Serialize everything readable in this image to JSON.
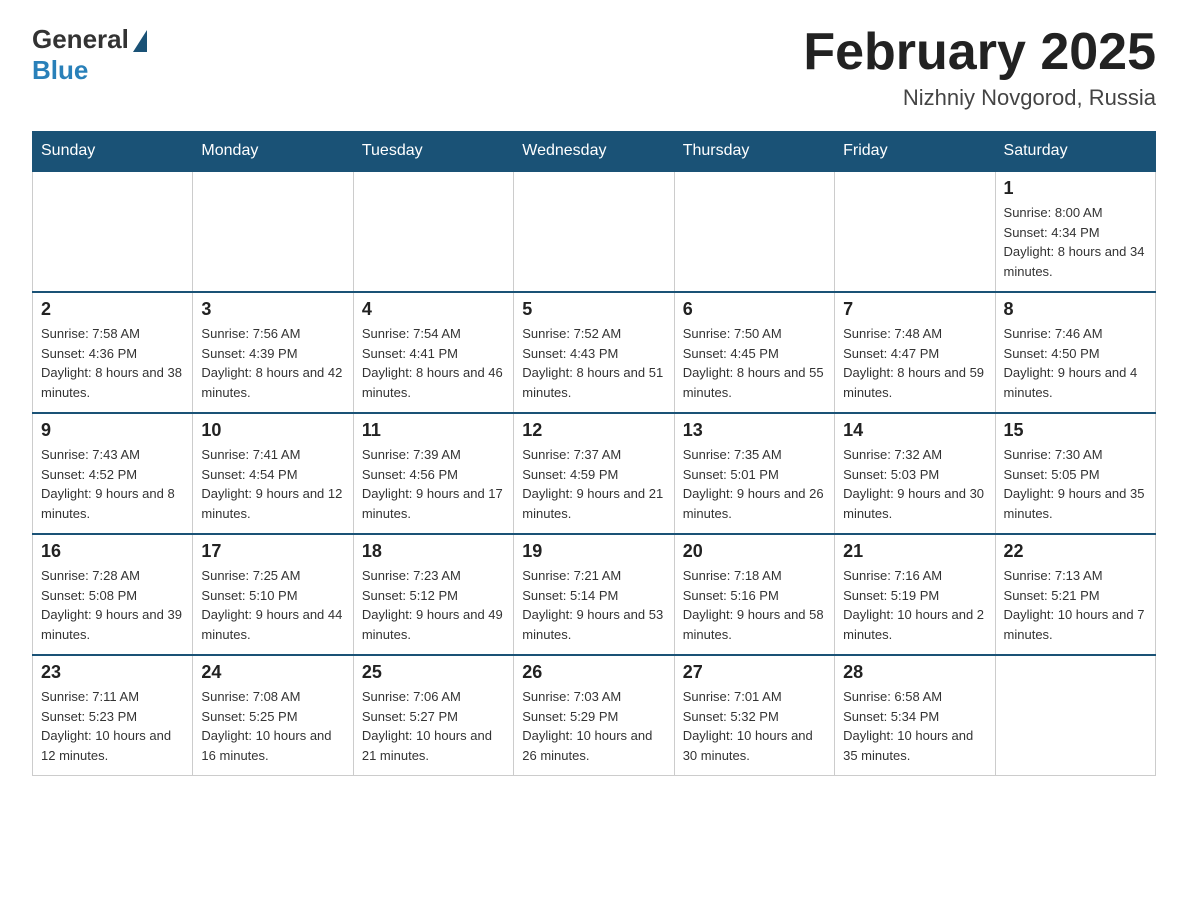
{
  "header": {
    "logo_general": "General",
    "logo_blue": "Blue",
    "month_title": "February 2025",
    "location": "Nizhniy Novgorod, Russia"
  },
  "weekdays": [
    "Sunday",
    "Monday",
    "Tuesday",
    "Wednesday",
    "Thursday",
    "Friday",
    "Saturday"
  ],
  "weeks": [
    [
      {
        "day": "",
        "info": ""
      },
      {
        "day": "",
        "info": ""
      },
      {
        "day": "",
        "info": ""
      },
      {
        "day": "",
        "info": ""
      },
      {
        "day": "",
        "info": ""
      },
      {
        "day": "",
        "info": ""
      },
      {
        "day": "1",
        "info": "Sunrise: 8:00 AM\nSunset: 4:34 PM\nDaylight: 8 hours and 34 minutes."
      }
    ],
    [
      {
        "day": "2",
        "info": "Sunrise: 7:58 AM\nSunset: 4:36 PM\nDaylight: 8 hours and 38 minutes."
      },
      {
        "day": "3",
        "info": "Sunrise: 7:56 AM\nSunset: 4:39 PM\nDaylight: 8 hours and 42 minutes."
      },
      {
        "day": "4",
        "info": "Sunrise: 7:54 AM\nSunset: 4:41 PM\nDaylight: 8 hours and 46 minutes."
      },
      {
        "day": "5",
        "info": "Sunrise: 7:52 AM\nSunset: 4:43 PM\nDaylight: 8 hours and 51 minutes."
      },
      {
        "day": "6",
        "info": "Sunrise: 7:50 AM\nSunset: 4:45 PM\nDaylight: 8 hours and 55 minutes."
      },
      {
        "day": "7",
        "info": "Sunrise: 7:48 AM\nSunset: 4:47 PM\nDaylight: 8 hours and 59 minutes."
      },
      {
        "day": "8",
        "info": "Sunrise: 7:46 AM\nSunset: 4:50 PM\nDaylight: 9 hours and 4 minutes."
      }
    ],
    [
      {
        "day": "9",
        "info": "Sunrise: 7:43 AM\nSunset: 4:52 PM\nDaylight: 9 hours and 8 minutes."
      },
      {
        "day": "10",
        "info": "Sunrise: 7:41 AM\nSunset: 4:54 PM\nDaylight: 9 hours and 12 minutes."
      },
      {
        "day": "11",
        "info": "Sunrise: 7:39 AM\nSunset: 4:56 PM\nDaylight: 9 hours and 17 minutes."
      },
      {
        "day": "12",
        "info": "Sunrise: 7:37 AM\nSunset: 4:59 PM\nDaylight: 9 hours and 21 minutes."
      },
      {
        "day": "13",
        "info": "Sunrise: 7:35 AM\nSunset: 5:01 PM\nDaylight: 9 hours and 26 minutes."
      },
      {
        "day": "14",
        "info": "Sunrise: 7:32 AM\nSunset: 5:03 PM\nDaylight: 9 hours and 30 minutes."
      },
      {
        "day": "15",
        "info": "Sunrise: 7:30 AM\nSunset: 5:05 PM\nDaylight: 9 hours and 35 minutes."
      }
    ],
    [
      {
        "day": "16",
        "info": "Sunrise: 7:28 AM\nSunset: 5:08 PM\nDaylight: 9 hours and 39 minutes."
      },
      {
        "day": "17",
        "info": "Sunrise: 7:25 AM\nSunset: 5:10 PM\nDaylight: 9 hours and 44 minutes."
      },
      {
        "day": "18",
        "info": "Sunrise: 7:23 AM\nSunset: 5:12 PM\nDaylight: 9 hours and 49 minutes."
      },
      {
        "day": "19",
        "info": "Sunrise: 7:21 AM\nSunset: 5:14 PM\nDaylight: 9 hours and 53 minutes."
      },
      {
        "day": "20",
        "info": "Sunrise: 7:18 AM\nSunset: 5:16 PM\nDaylight: 9 hours and 58 minutes."
      },
      {
        "day": "21",
        "info": "Sunrise: 7:16 AM\nSunset: 5:19 PM\nDaylight: 10 hours and 2 minutes."
      },
      {
        "day": "22",
        "info": "Sunrise: 7:13 AM\nSunset: 5:21 PM\nDaylight: 10 hours and 7 minutes."
      }
    ],
    [
      {
        "day": "23",
        "info": "Sunrise: 7:11 AM\nSunset: 5:23 PM\nDaylight: 10 hours and 12 minutes."
      },
      {
        "day": "24",
        "info": "Sunrise: 7:08 AM\nSunset: 5:25 PM\nDaylight: 10 hours and 16 minutes."
      },
      {
        "day": "25",
        "info": "Sunrise: 7:06 AM\nSunset: 5:27 PM\nDaylight: 10 hours and 21 minutes."
      },
      {
        "day": "26",
        "info": "Sunrise: 7:03 AM\nSunset: 5:29 PM\nDaylight: 10 hours and 26 minutes."
      },
      {
        "day": "27",
        "info": "Sunrise: 7:01 AM\nSunset: 5:32 PM\nDaylight: 10 hours and 30 minutes."
      },
      {
        "day": "28",
        "info": "Sunrise: 6:58 AM\nSunset: 5:34 PM\nDaylight: 10 hours and 35 minutes."
      },
      {
        "day": "",
        "info": ""
      }
    ]
  ]
}
